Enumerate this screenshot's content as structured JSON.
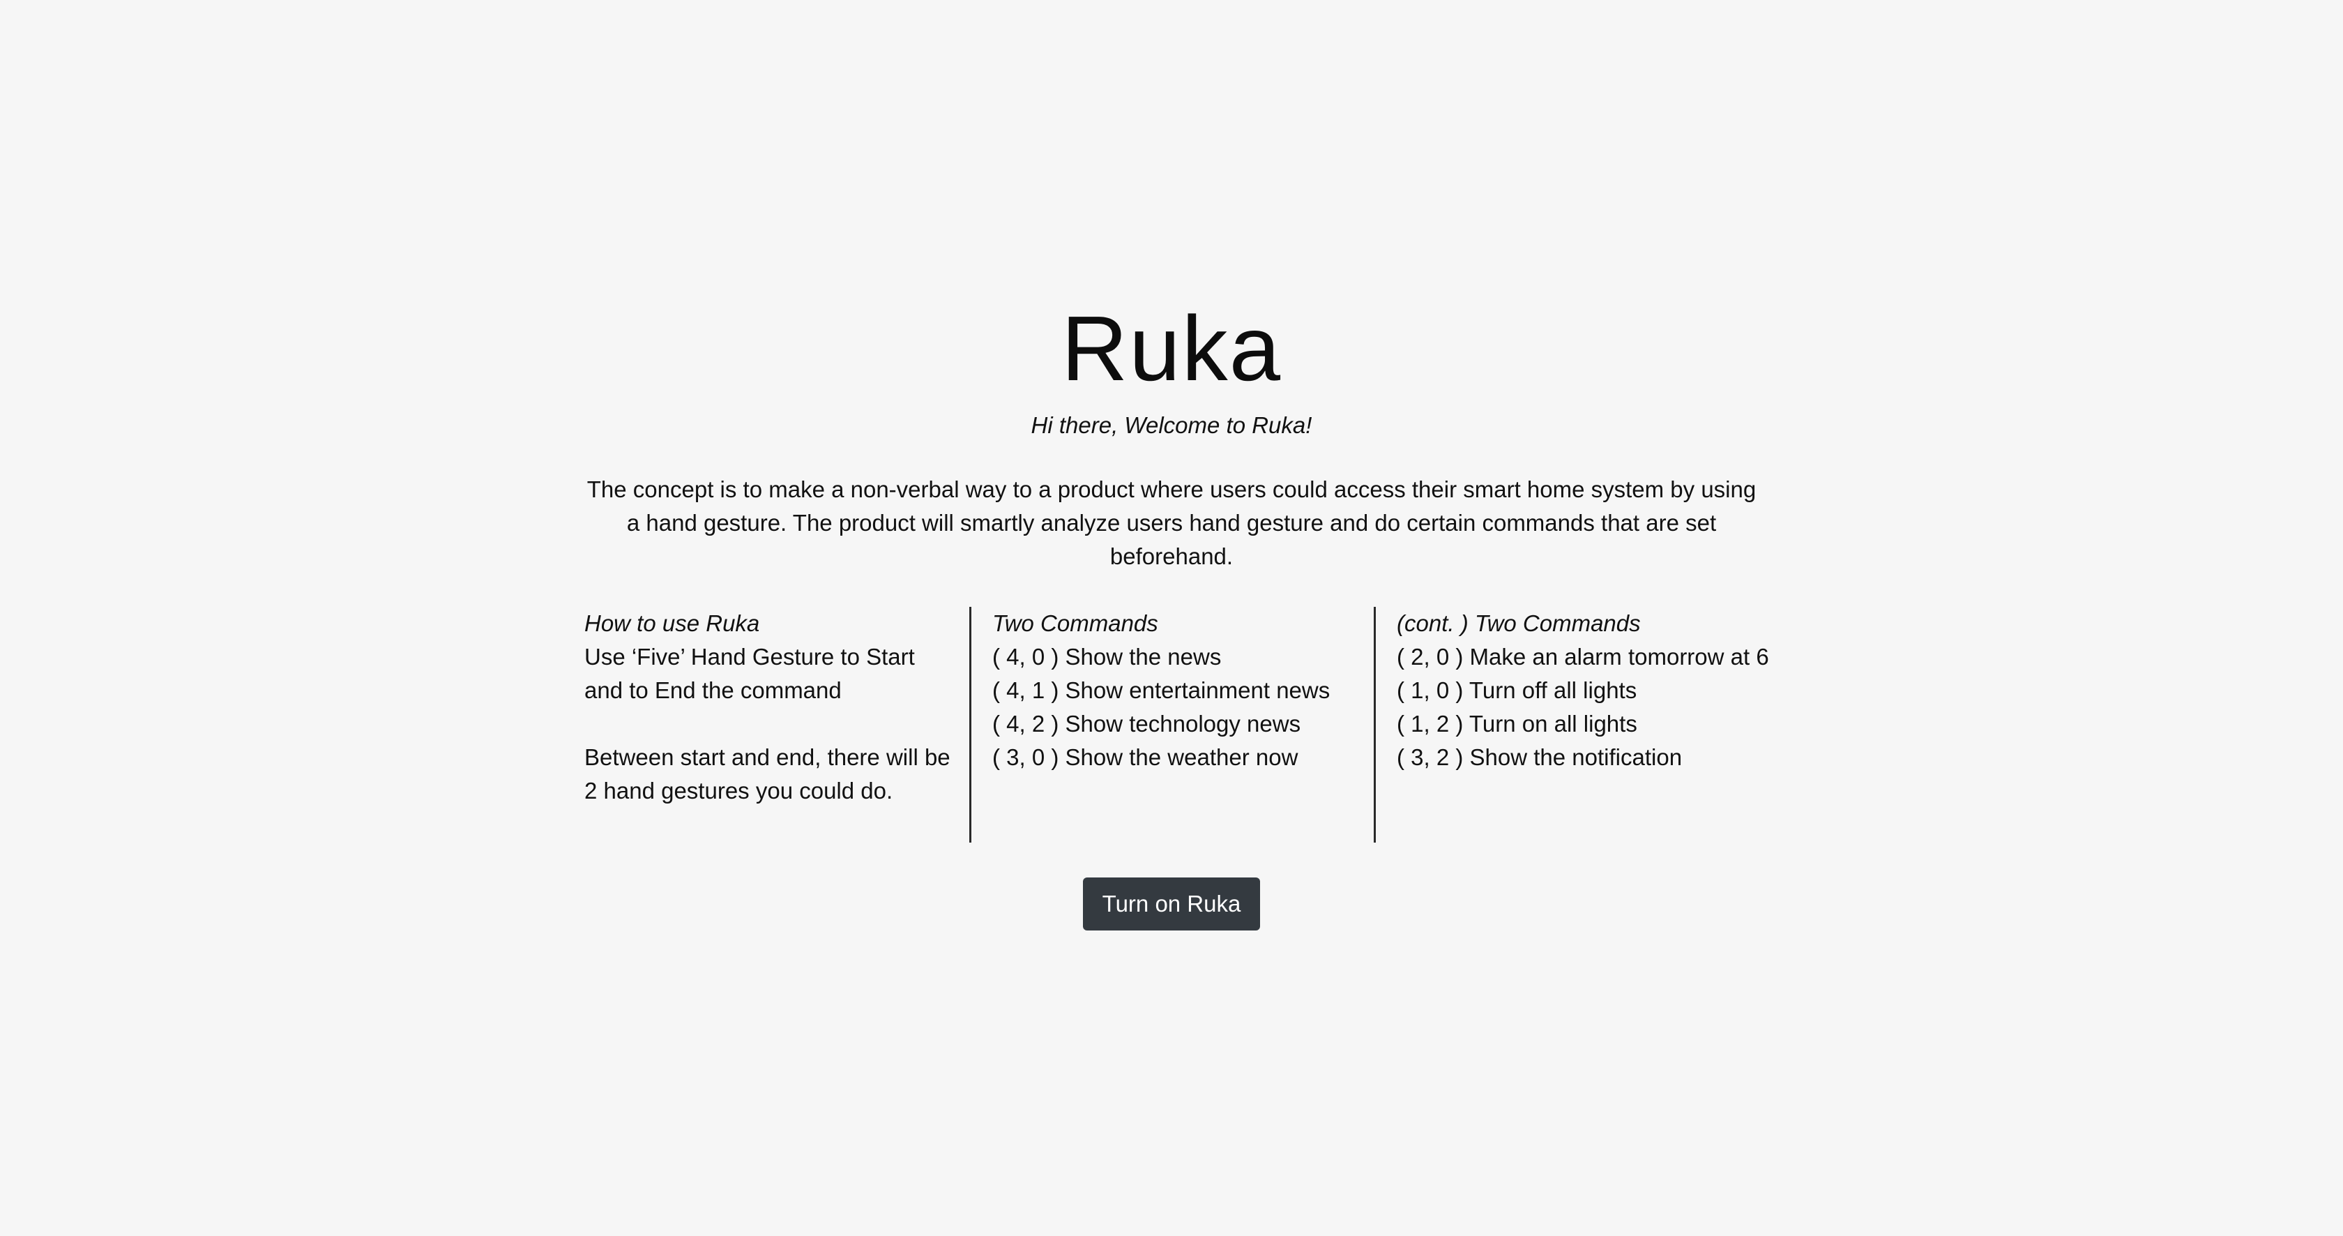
{
  "header": {
    "title": "Ruka",
    "subtitle": "Hi there, Welcome to Ruka!"
  },
  "description": "The concept is to make a non-verbal way to a product where users could access their smart home system by using a hand gesture. The product will smartly analyze users hand gesture and do certain commands that are set beforehand.",
  "how_to": {
    "heading": "How to use Ruka",
    "paragraphs": [
      "Use ‘Five’ Hand Gesture to Start and to End the command",
      "Between start and end, there will be 2 hand gestures you could do."
    ]
  },
  "commands": {
    "heading": "Two Commands",
    "items": [
      "( 4, 0 ) Show the news",
      "( 4, 1 ) Show entertainment news",
      "( 4, 2 ) Show technology news",
      "( 3, 0 ) Show the weather now"
    ]
  },
  "commands_cont": {
    "heading": "(cont. ) Two Commands",
    "items": [
      "( 2, 0 ) Make an alarm tomorrow at 6",
      "( 1, 0 ) Turn off all lights",
      "( 1, 2 ) Turn on all lights",
      "( 3, 2 ) Show the notification"
    ]
  },
  "actions": {
    "turn_on_label": "Turn on Ruka"
  },
  "colors": {
    "background": "#f6f6f6",
    "button": "#343a40",
    "button_text": "#ffffff",
    "divider": "#2a2a2a"
  }
}
